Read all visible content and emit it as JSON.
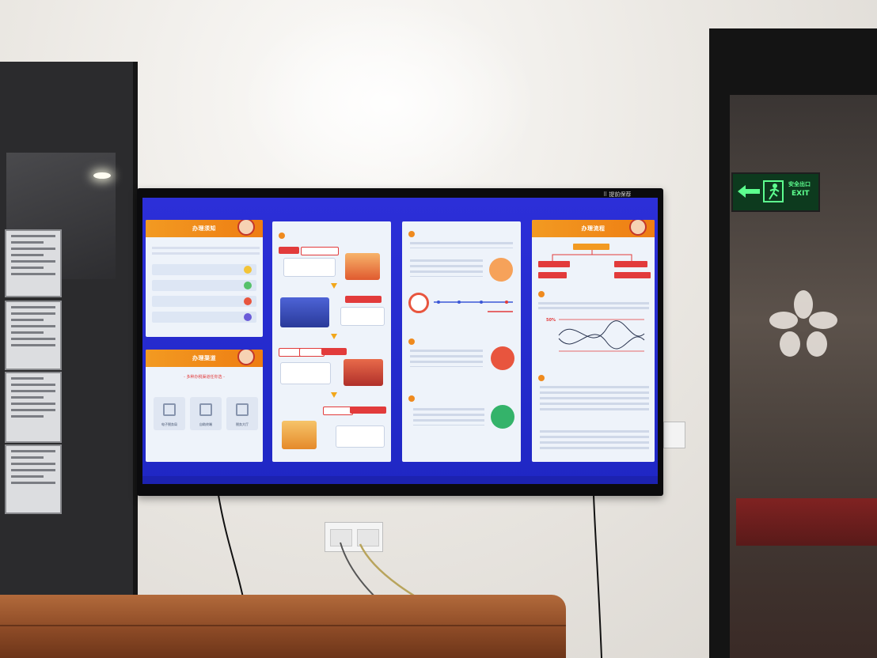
{
  "scene": {
    "description_colors": {
      "wall": "#e9e6e1",
      "screen_background": "#2c2fd8",
      "accent_orange": "#f29a22",
      "accent_red": "#e23b3b"
    }
  },
  "tv": {
    "corner_label": "⠿ 提前保荐"
  },
  "exit_sign": {
    "cn": "安全出口",
    "en": "EXIT"
  },
  "screen": {
    "left_top": {
      "banner_title": "办理须知"
    },
    "left_bottom": {
      "banner_title": "办理渠道",
      "subtitle": "- 多种办税渠道任你选 -"
    },
    "right_top": {
      "banner_title": "办理流程"
    },
    "tiles": [
      {
        "label": "电子税务局"
      },
      {
        "label": "自助终端"
      },
      {
        "label": "税务大厅"
      }
    ],
    "right_pct": "50%"
  }
}
